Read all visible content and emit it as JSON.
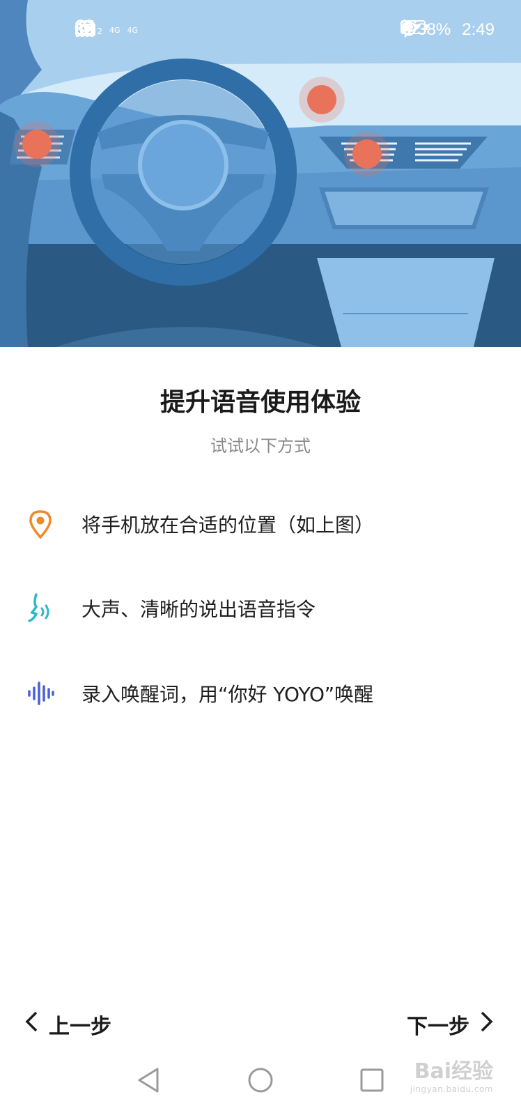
{
  "status_bar": {
    "hd_badge": "HD",
    "hd_sub": "2",
    "network_1": "4G",
    "network_2": "4G",
    "battery_percent": "38%",
    "time": "2:49",
    "icons": [
      "eye-comfort-icon",
      "alarm-icon",
      "bluetooth-icon",
      "battery-icon",
      "wifi-icon",
      "health-icon",
      "signal-icon"
    ]
  },
  "hero": {
    "description_icons": [
      "car-dashboard-illustration",
      "steering-wheel",
      "phone-position-marker"
    ]
  },
  "content": {
    "title": "提升语音使用体验",
    "subtitle": "试试以下方式",
    "tips": [
      {
        "icon": "location-pin-icon",
        "text": "将手机放在合适的位置（如上图）"
      },
      {
        "icon": "speaking-face-icon",
        "text": "大声、清晰的说出语音指令"
      },
      {
        "icon": "voice-wave-icon",
        "text": "录入唤醒词，用“你好 YOYO”唤醒"
      }
    ]
  },
  "navigation": {
    "prev_label": "上一步",
    "next_label": "下一步"
  },
  "system_nav": {
    "buttons": [
      "back-icon",
      "home-icon",
      "recents-icon"
    ]
  },
  "watermark": {
    "text": "Bai经验",
    "sub": "jingyan.baidu.com"
  },
  "colors": {
    "marker": "#e8735a",
    "pin": "#f08a24",
    "face": "#2bb8c9",
    "wave": "#4a5fd8",
    "hero_sky": "#a7cdee",
    "hero_dark": "#2a5a84"
  }
}
